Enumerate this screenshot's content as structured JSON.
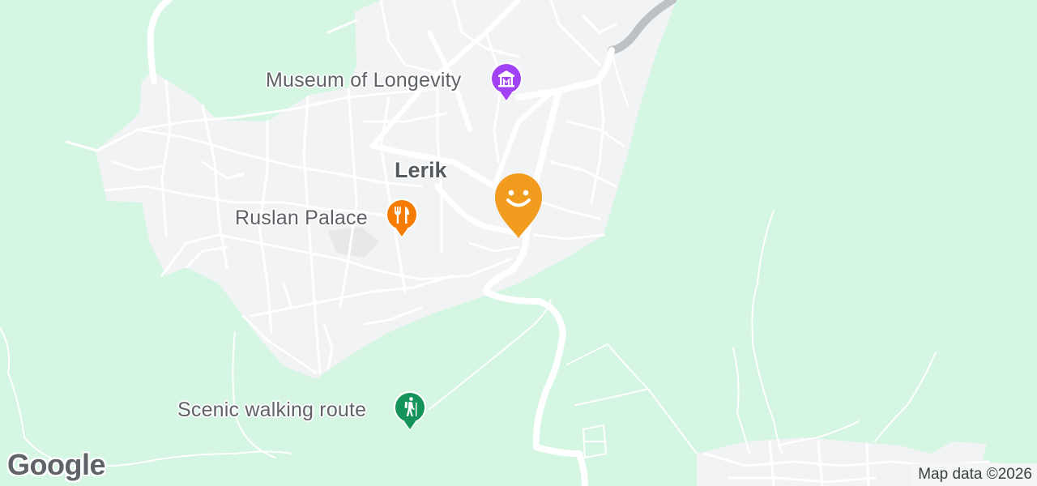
{
  "map": {
    "town": "Lerik",
    "colors": {
      "land": "#d4f6e2",
      "urban": "#f1f3f4",
      "road": "#ffffff",
      "main_road": "#bdc1c6",
      "museum_pin": "#a142f4",
      "restaurant_pin": "#f57c00",
      "trail_pin": "#13925a",
      "location_pin": "#f29c1f"
    }
  },
  "pois": [
    {
      "name": "Museum of Longevity",
      "icon": "museum-icon",
      "color": "#a142f4"
    },
    {
      "name": "Ruslan Palace",
      "icon": "restaurant-icon",
      "color": "#f57c00"
    },
    {
      "name": "Scenic walking route",
      "icon": "hiking-icon",
      "color": "#13925a"
    }
  ],
  "location_pin": {
    "icon": "smiley-icon",
    "color": "#f29c1f"
  },
  "branding": {
    "logo": "Google"
  },
  "attribution": "Map data ©2026"
}
